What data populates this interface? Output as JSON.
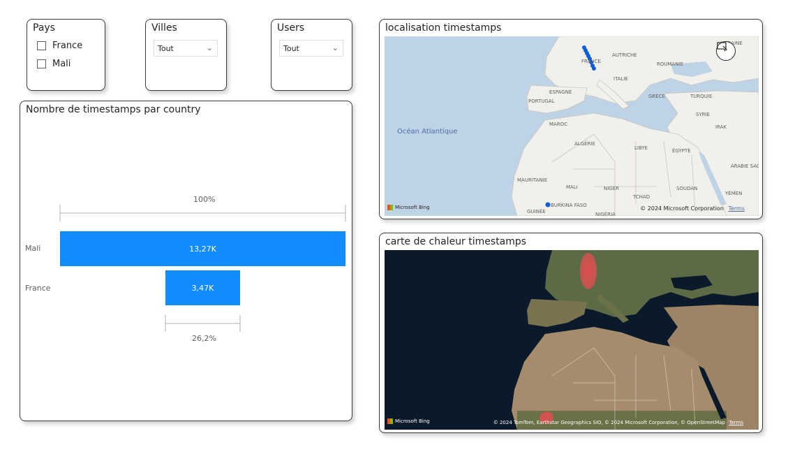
{
  "slicers": {
    "pays": {
      "title": "Pays",
      "options": [
        "France",
        "Mali"
      ]
    },
    "villes": {
      "title": "Villes",
      "selected": "Tout"
    },
    "users": {
      "title": "Users",
      "selected": "Tout"
    }
  },
  "funnel": {
    "title": "Nombre de timestamps par country",
    "top_pct": "100%",
    "bottom_pct": "26,2%",
    "chart_data": {
      "type": "bar",
      "categories": [
        "Mali",
        "France"
      ],
      "values": [
        13270,
        3470
      ],
      "labels": [
        "13,27K",
        "3,47K"
      ],
      "conversion": [
        "100%",
        "26,2%"
      ]
    }
  },
  "map1": {
    "title": "localisation timestamps",
    "ocean": "Océan Atlantique",
    "countries": [
      "FRANCE",
      "UKRAINE",
      "AUTRICHE",
      "ROUMANIE",
      "ITALIE",
      "ESPAGNE",
      "PORTUGAL",
      "GRÈCE",
      "TURQUIE",
      "SYRIE",
      "IRAK",
      "MAROC",
      "ALGÉRIE",
      "LIBYE",
      "ÉGYPTE",
      "ARABIE SAOUDITE",
      "MAURITANIE",
      "MALI",
      "NIGER",
      "TCHAD",
      "SOUDAN",
      "YÉMEN",
      "BURKINA FASO",
      "GUINÉE",
      "NIGÉRIA"
    ],
    "attribution": "© 2024 Microsoft Corporation",
    "terms": "Terms",
    "logo": "Microsoft Bing"
  },
  "map2": {
    "title": "carte de chaleur timestamps",
    "attribution": "© 2024 TomTom, Earthstar Geographics SIO, © 2024 Microsoft Corporation, © OpenStreetMap",
    "terms": "Terms",
    "logo": "Microsoft Bing"
  },
  "colors": {
    "bar": "#118dff",
    "point": "#0b5fd6",
    "heat": "#e34e50",
    "land": "#f2f0ea",
    "sea": "#bfd3e6"
  }
}
